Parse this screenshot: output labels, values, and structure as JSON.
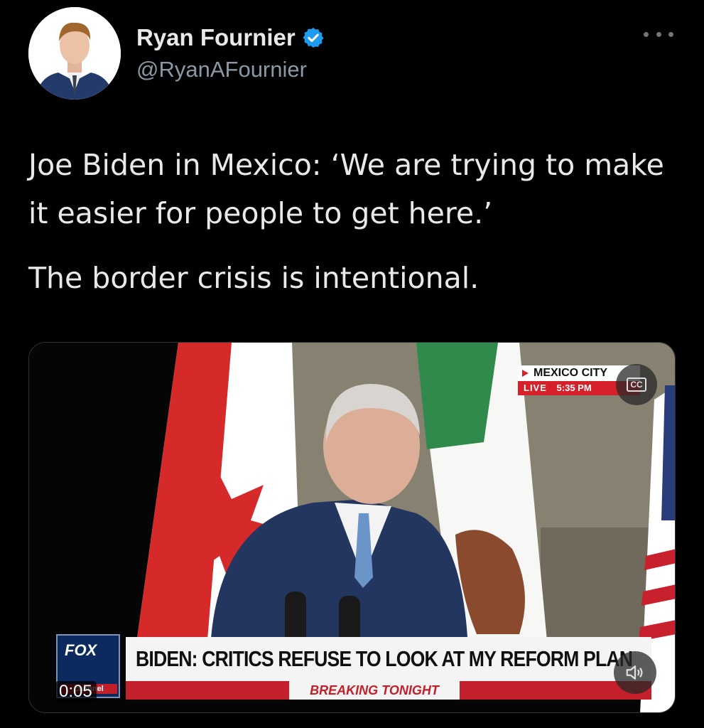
{
  "author": {
    "display_name": "Ryan Fournier",
    "handle": "@RyanAFournier",
    "verified": true
  },
  "tweet": {
    "paragraphs": [
      "Joe Biden in Mexico: ‘We are trying to make it easier for people to get here.’",
      "The border crisis is intentional."
    ]
  },
  "video": {
    "location": "MEXICO CITY",
    "live_label": "LIVE",
    "live_time": "5:35 PM",
    "network": "FOX",
    "network_sub": "channel",
    "headline": "BIDEN: CRITICS REFUSE TO LOOK AT MY REFORM PLAN",
    "banner": "BREAKING TONIGHT",
    "elapsed": "0:05",
    "cc_label": "CC"
  },
  "colors": {
    "background": "#000000",
    "text": "#e7e9ea",
    "secondary": "#8b98a5",
    "verified": "#1d9bf0",
    "fox_red": "#c3202b"
  },
  "icons": [
    "verified-badge-icon",
    "more-icon",
    "captions-icon",
    "volume-icon"
  ]
}
